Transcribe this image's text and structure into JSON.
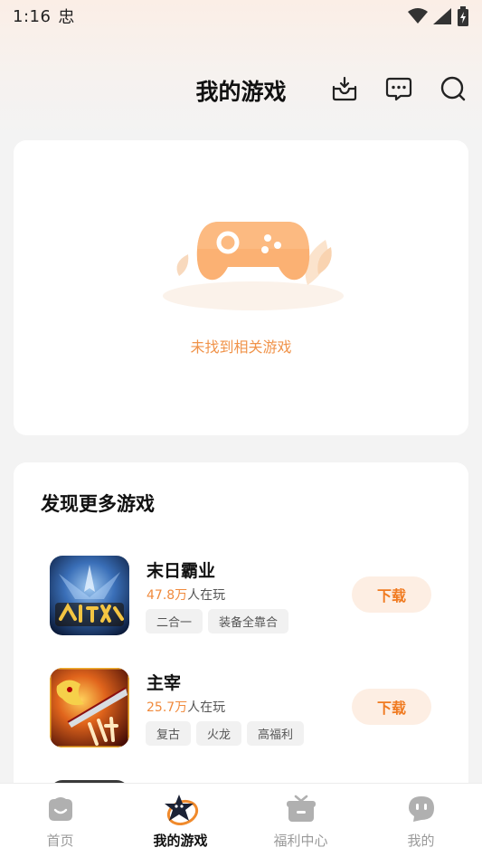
{
  "status_bar": {
    "time": "1:16",
    "app_glyph": "忠"
  },
  "header": {
    "title": "我的游戏",
    "icons": [
      "download-box-icon",
      "message-icon",
      "search-icon"
    ]
  },
  "empty_state": {
    "text": "未找到相关游戏",
    "icon": "gamepad-icon"
  },
  "discover": {
    "title": "发现更多游戏",
    "games": [
      {
        "name": "末日霸业",
        "players_num": "47.8万",
        "players_suffix": "人在玩",
        "tags": [
          "二合一",
          "装备全靠合"
        ],
        "button": "下载"
      },
      {
        "name": "主宰",
        "players_num": "25.7万",
        "players_suffix": "人在玩",
        "tags": [
          "复古",
          "火龙",
          "高福利"
        ],
        "button": "下载"
      }
    ]
  },
  "tabbar": {
    "items": [
      {
        "label": "首页",
        "icon": "home-icon"
      },
      {
        "label": "我的游戏",
        "icon": "my-games-icon"
      },
      {
        "label": "福利中心",
        "icon": "gift-icon"
      },
      {
        "label": "我的",
        "icon": "profile-icon"
      }
    ],
    "active_index": 1
  },
  "colors": {
    "accent": "#f07a20",
    "accent_light": "#fdeee3",
    "inactive": "#9a9a9a"
  }
}
